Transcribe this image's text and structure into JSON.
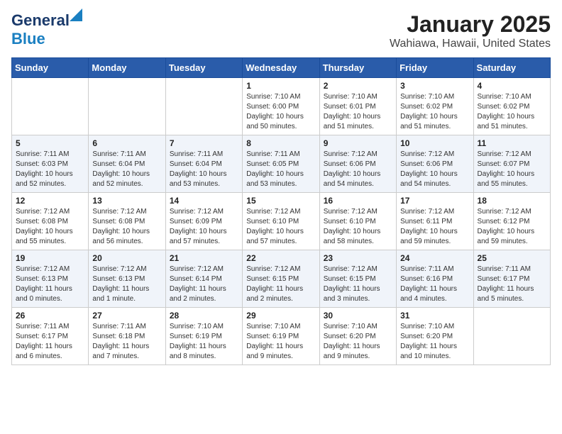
{
  "header": {
    "logo_line1": "General",
    "logo_line2": "Blue",
    "title": "January 2025",
    "subtitle": "Wahiawa, Hawaii, United States"
  },
  "calendar": {
    "days_of_week": [
      "Sunday",
      "Monday",
      "Tuesday",
      "Wednesday",
      "Thursday",
      "Friday",
      "Saturday"
    ],
    "weeks": [
      [
        {
          "day": "",
          "info": ""
        },
        {
          "day": "",
          "info": ""
        },
        {
          "day": "",
          "info": ""
        },
        {
          "day": "1",
          "info": "Sunrise: 7:10 AM\nSunset: 6:00 PM\nDaylight: 10 hours\nand 50 minutes."
        },
        {
          "day": "2",
          "info": "Sunrise: 7:10 AM\nSunset: 6:01 PM\nDaylight: 10 hours\nand 51 minutes."
        },
        {
          "day": "3",
          "info": "Sunrise: 7:10 AM\nSunset: 6:02 PM\nDaylight: 10 hours\nand 51 minutes."
        },
        {
          "day": "4",
          "info": "Sunrise: 7:10 AM\nSunset: 6:02 PM\nDaylight: 10 hours\nand 51 minutes."
        }
      ],
      [
        {
          "day": "5",
          "info": "Sunrise: 7:11 AM\nSunset: 6:03 PM\nDaylight: 10 hours\nand 52 minutes."
        },
        {
          "day": "6",
          "info": "Sunrise: 7:11 AM\nSunset: 6:04 PM\nDaylight: 10 hours\nand 52 minutes."
        },
        {
          "day": "7",
          "info": "Sunrise: 7:11 AM\nSunset: 6:04 PM\nDaylight: 10 hours\nand 53 minutes."
        },
        {
          "day": "8",
          "info": "Sunrise: 7:11 AM\nSunset: 6:05 PM\nDaylight: 10 hours\nand 53 minutes."
        },
        {
          "day": "9",
          "info": "Sunrise: 7:12 AM\nSunset: 6:06 PM\nDaylight: 10 hours\nand 54 minutes."
        },
        {
          "day": "10",
          "info": "Sunrise: 7:12 AM\nSunset: 6:06 PM\nDaylight: 10 hours\nand 54 minutes."
        },
        {
          "day": "11",
          "info": "Sunrise: 7:12 AM\nSunset: 6:07 PM\nDaylight: 10 hours\nand 55 minutes."
        }
      ],
      [
        {
          "day": "12",
          "info": "Sunrise: 7:12 AM\nSunset: 6:08 PM\nDaylight: 10 hours\nand 55 minutes."
        },
        {
          "day": "13",
          "info": "Sunrise: 7:12 AM\nSunset: 6:08 PM\nDaylight: 10 hours\nand 56 minutes."
        },
        {
          "day": "14",
          "info": "Sunrise: 7:12 AM\nSunset: 6:09 PM\nDaylight: 10 hours\nand 57 minutes."
        },
        {
          "day": "15",
          "info": "Sunrise: 7:12 AM\nSunset: 6:10 PM\nDaylight: 10 hours\nand 57 minutes."
        },
        {
          "day": "16",
          "info": "Sunrise: 7:12 AM\nSunset: 6:10 PM\nDaylight: 10 hours\nand 58 minutes."
        },
        {
          "day": "17",
          "info": "Sunrise: 7:12 AM\nSunset: 6:11 PM\nDaylight: 10 hours\nand 59 minutes."
        },
        {
          "day": "18",
          "info": "Sunrise: 7:12 AM\nSunset: 6:12 PM\nDaylight: 10 hours\nand 59 minutes."
        }
      ],
      [
        {
          "day": "19",
          "info": "Sunrise: 7:12 AM\nSunset: 6:13 PM\nDaylight: 11 hours\nand 0 minutes."
        },
        {
          "day": "20",
          "info": "Sunrise: 7:12 AM\nSunset: 6:13 PM\nDaylight: 11 hours\nand 1 minute."
        },
        {
          "day": "21",
          "info": "Sunrise: 7:12 AM\nSunset: 6:14 PM\nDaylight: 11 hours\nand 2 minutes."
        },
        {
          "day": "22",
          "info": "Sunrise: 7:12 AM\nSunset: 6:15 PM\nDaylight: 11 hours\nand 2 minutes."
        },
        {
          "day": "23",
          "info": "Sunrise: 7:12 AM\nSunset: 6:15 PM\nDaylight: 11 hours\nand 3 minutes."
        },
        {
          "day": "24",
          "info": "Sunrise: 7:11 AM\nSunset: 6:16 PM\nDaylight: 11 hours\nand 4 minutes."
        },
        {
          "day": "25",
          "info": "Sunrise: 7:11 AM\nSunset: 6:17 PM\nDaylight: 11 hours\nand 5 minutes."
        }
      ],
      [
        {
          "day": "26",
          "info": "Sunrise: 7:11 AM\nSunset: 6:17 PM\nDaylight: 11 hours\nand 6 minutes."
        },
        {
          "day": "27",
          "info": "Sunrise: 7:11 AM\nSunset: 6:18 PM\nDaylight: 11 hours\nand 7 minutes."
        },
        {
          "day": "28",
          "info": "Sunrise: 7:10 AM\nSunset: 6:19 PM\nDaylight: 11 hours\nand 8 minutes."
        },
        {
          "day": "29",
          "info": "Sunrise: 7:10 AM\nSunset: 6:19 PM\nDaylight: 11 hours\nand 9 minutes."
        },
        {
          "day": "30",
          "info": "Sunrise: 7:10 AM\nSunset: 6:20 PM\nDaylight: 11 hours\nand 9 minutes."
        },
        {
          "day": "31",
          "info": "Sunrise: 7:10 AM\nSunset: 6:20 PM\nDaylight: 11 hours\nand 10 minutes."
        },
        {
          "day": "",
          "info": ""
        }
      ]
    ]
  }
}
